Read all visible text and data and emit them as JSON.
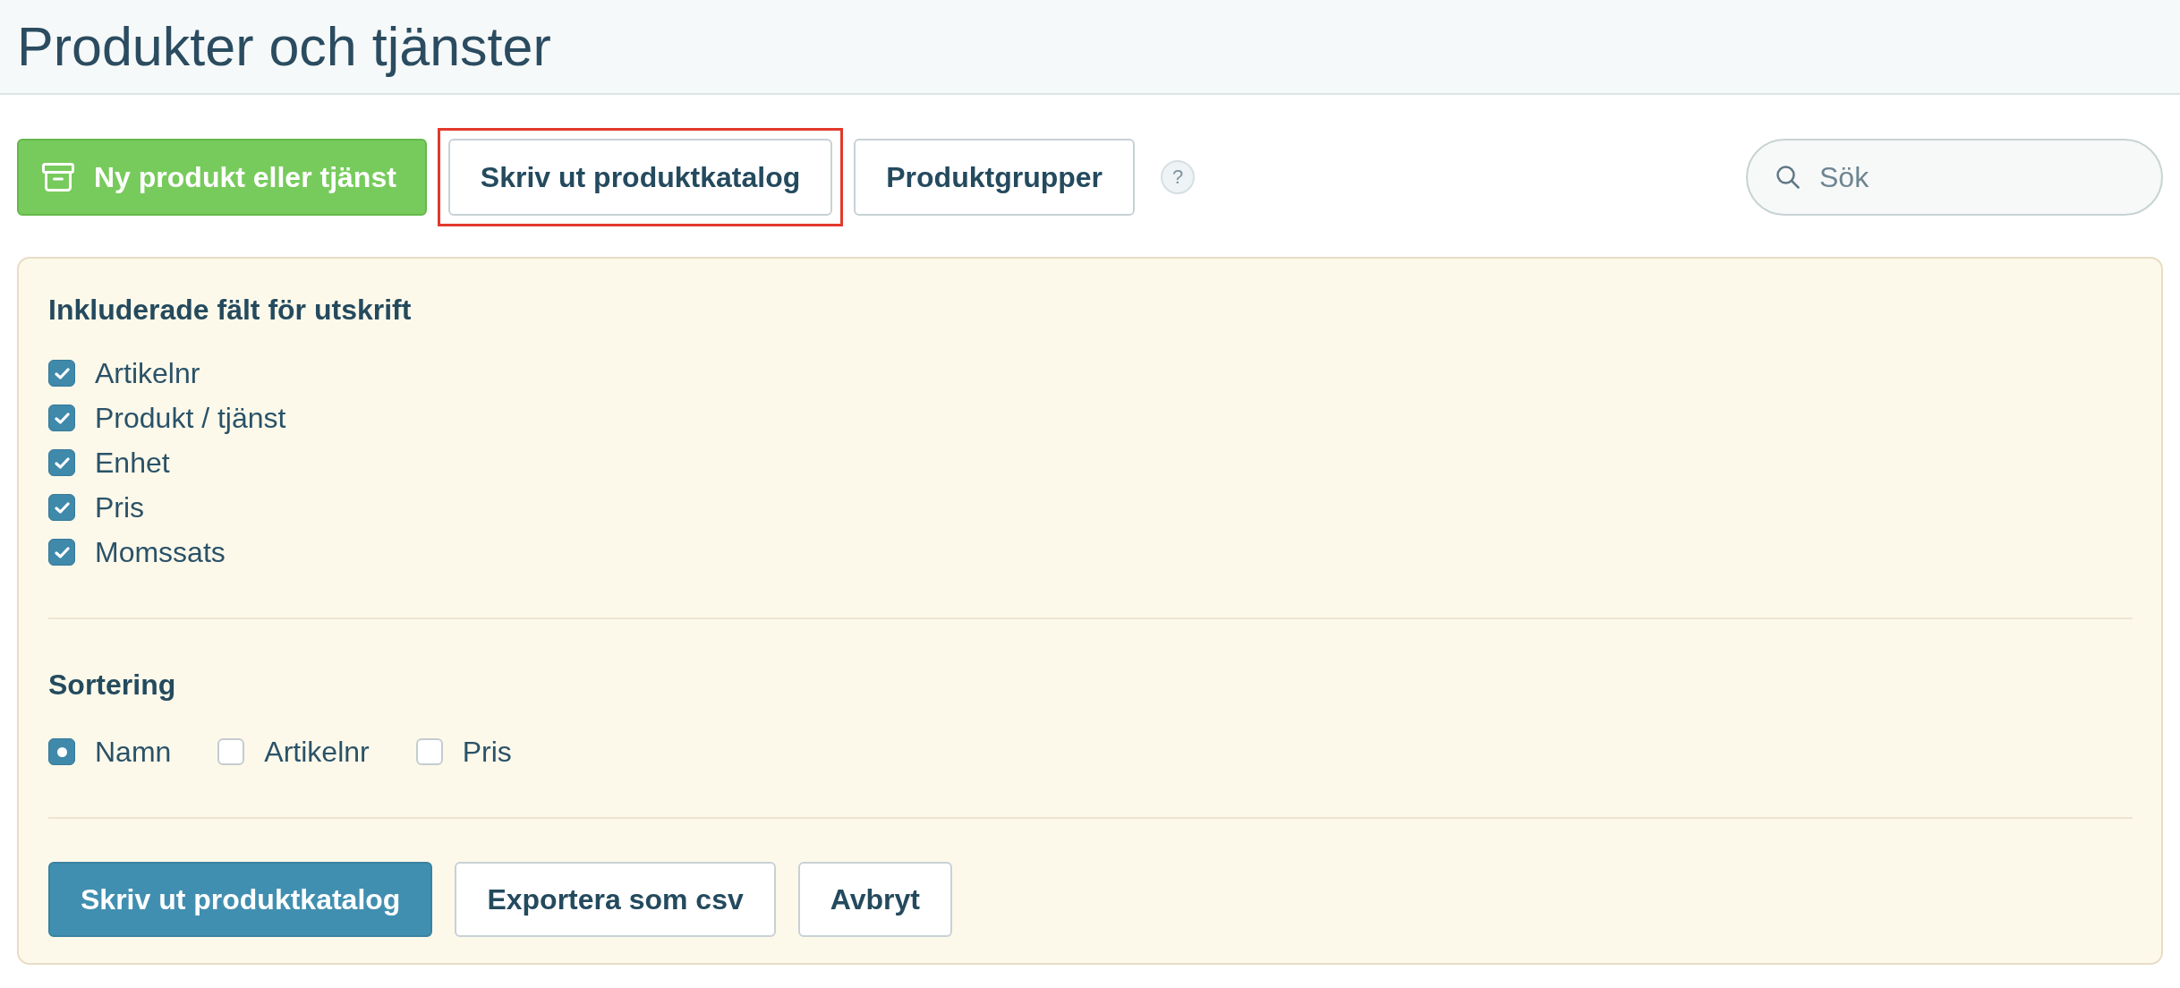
{
  "header": {
    "title": "Produkter och tjänster"
  },
  "toolbar": {
    "buttons": [
      {
        "label": "Ny produkt eller tjänst",
        "kind": "create",
        "highlighted": false
      },
      {
        "label": "Skriv ut produktkatalog",
        "kind": "secondary",
        "highlighted": true
      },
      {
        "label": "Produktgrupper",
        "kind": "secondary",
        "highlighted": false
      }
    ],
    "help": "?",
    "search": {
      "placeholder": "Sök"
    }
  },
  "print_panel": {
    "fields_heading": "Inkluderade fält för utskrift",
    "fields": [
      {
        "label": "Artikelnr",
        "checked": true
      },
      {
        "label": "Produkt / tjänst",
        "checked": true
      },
      {
        "label": "Enhet",
        "checked": true
      },
      {
        "label": "Pris",
        "checked": true
      },
      {
        "label": "Momssats",
        "checked": true
      }
    ],
    "sort_heading": "Sortering",
    "sort_options": [
      {
        "label": "Namn",
        "selected": true
      },
      {
        "label": "Artikelnr",
        "selected": false
      },
      {
        "label": "Pris",
        "selected": false
      }
    ],
    "actions": [
      {
        "label": "Skriv ut produktkatalog",
        "kind": "primary"
      },
      {
        "label": "Exportera som csv",
        "kind": "secondary"
      },
      {
        "label": "Avbryt",
        "kind": "secondary"
      }
    ]
  }
}
